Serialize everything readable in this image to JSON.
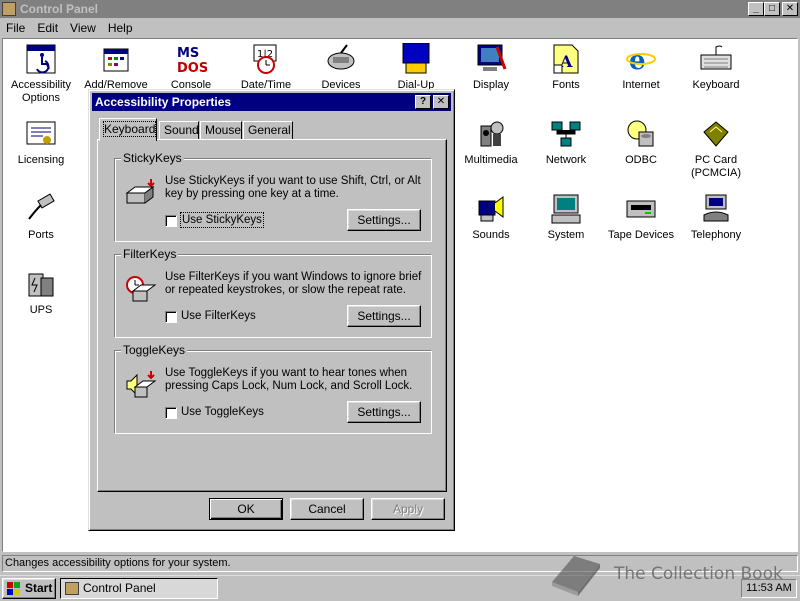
{
  "window": {
    "title": "Control Panel"
  },
  "menu": [
    "File",
    "Edit",
    "View",
    "Help"
  ],
  "caption_buttons": {
    "minimize": "_",
    "maximize": "□",
    "close": "✕",
    "help": "?"
  },
  "icons": [
    {
      "label": "Accessibility Options",
      "icon": "accessibility-icon"
    },
    {
      "label": "Add/Remove",
      "icon": "add-remove-icon"
    },
    {
      "label": "Console",
      "icon": "console-icon"
    },
    {
      "label": "Date/Time",
      "icon": "datetime-icon"
    },
    {
      "label": "Devices",
      "icon": "devices-icon"
    },
    {
      "label": "Dial-Up",
      "icon": "dialup-icon"
    },
    {
      "label": "Display",
      "icon": "display-icon"
    },
    {
      "label": "Fonts",
      "icon": "fonts-icon"
    },
    {
      "label": "Internet",
      "icon": "internet-icon"
    },
    {
      "label": "Keyboard",
      "icon": "keyboard-icon"
    },
    {
      "label": "Licensing",
      "icon": "licensing-icon"
    },
    {
      "label": "Multimedia",
      "icon": "multimedia-icon"
    },
    {
      "label": "Network",
      "icon": "network-icon"
    },
    {
      "label": "ODBC",
      "icon": "odbc-icon"
    },
    {
      "label": "PC Card (PCMCIA)",
      "icon": "pccard-icon"
    },
    {
      "label": "Ports",
      "icon": "ports-icon"
    },
    {
      "label": "Sounds",
      "icon": "sounds-icon"
    },
    {
      "label": "System",
      "icon": "system-icon"
    },
    {
      "label": "Tape Devices",
      "icon": "tape-devices-icon"
    },
    {
      "label": "Telephony",
      "icon": "telephony-icon"
    },
    {
      "label": "UPS",
      "icon": "ups-icon"
    }
  ],
  "status": "Changes accessibility options for your system.",
  "taskbar": {
    "start": "Start",
    "task": "Control Panel",
    "clock": "11:53 AM"
  },
  "watermark": "The Collection Book",
  "dialog": {
    "title": "Accessibility Properties",
    "tabs": [
      "Keyboard",
      "Sound",
      "Mouse",
      "General"
    ],
    "groups": [
      {
        "name": "StickyKeys",
        "description": "Use StickyKeys if you want to use Shift, Ctrl, or Alt key by pressing one key at a time.",
        "checkbox": "Use StickyKeys",
        "checked": false,
        "settings": "Settings..."
      },
      {
        "name": "FilterKeys",
        "description": "Use FilterKeys if you want Windows to ignore brief or repeated keystrokes, or slow the repeat rate.",
        "checkbox": "Use FilterKeys",
        "checked": false,
        "settings": "Settings..."
      },
      {
        "name": "ToggleKeys",
        "description": "Use ToggleKeys if you want to hear tones when pressing Caps Lock, Num Lock, and Scroll Lock.",
        "checkbox": "Use ToggleKeys",
        "checked": false,
        "settings": "Settings..."
      }
    ],
    "buttons": {
      "ok": "OK",
      "cancel": "Cancel",
      "apply": "Apply"
    }
  },
  "colors": {
    "desktop": "#c0c0c0",
    "active_title": "#000080",
    "inactive_title": "#808080",
    "window_bg": "#ffffff"
  }
}
